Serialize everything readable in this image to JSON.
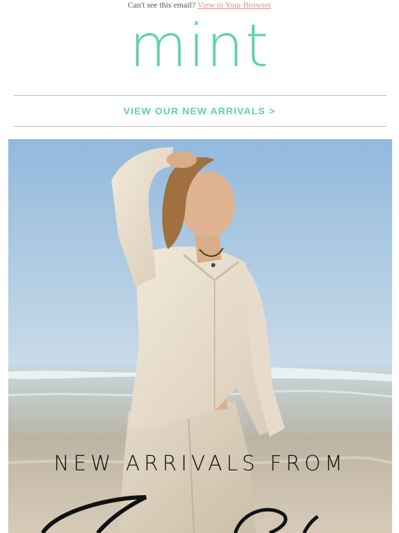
{
  "header": {
    "cant_see_text": "Can't see this email?",
    "view_browser_link": "View in Your Browser"
  },
  "brand": {
    "logo_text": "mint",
    "color": "#5fd1ab"
  },
  "nav": {
    "new_arrivals_link": "VIEW OUR NEW ARRIVALS >"
  },
  "hero": {
    "headline": "NEW ARRIVALS FROM"
  },
  "colors": {
    "link_pink": "#e88a8a",
    "sky": "#9fc1df",
    "headline": "#111111"
  }
}
